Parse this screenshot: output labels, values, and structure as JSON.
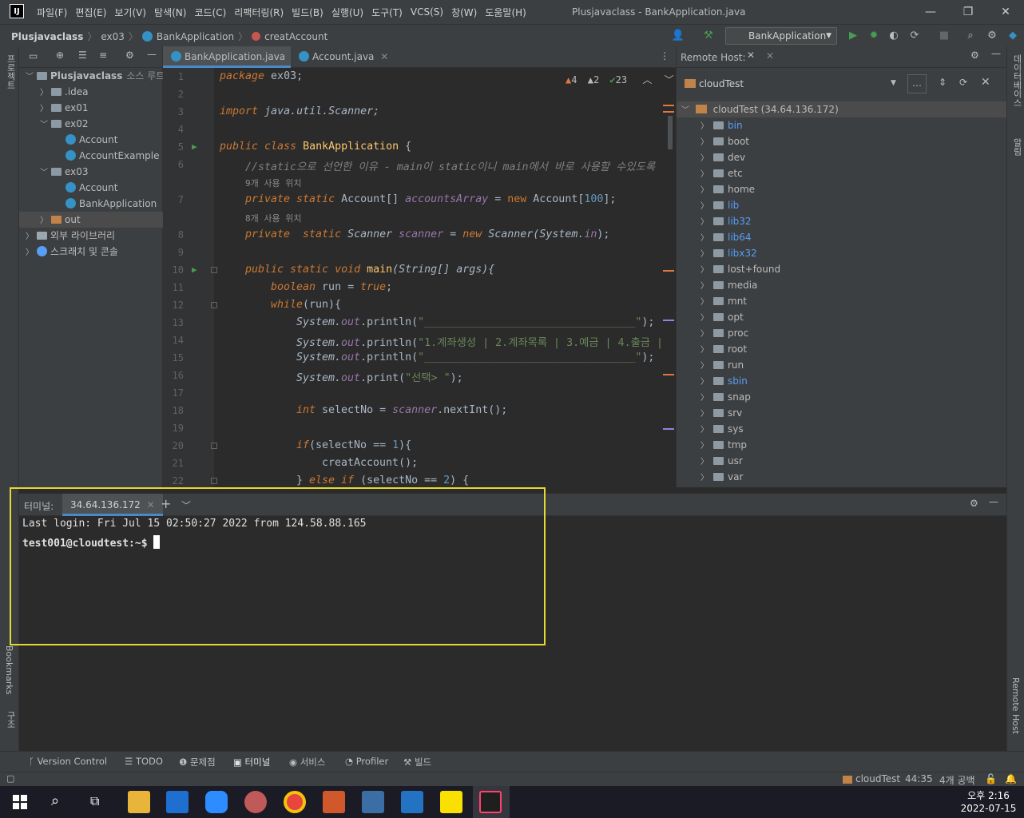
{
  "window": {
    "title": "Plusjavaclass - BankApplication.java",
    "menus": [
      "파일(F)",
      "편집(E)",
      "보기(V)",
      "탐색(N)",
      "코드(C)",
      "리팩터링(R)",
      "빌드(B)",
      "실행(U)",
      "도구(T)",
      "VCS(S)",
      "창(W)",
      "도움말(H)"
    ],
    "logo": "IJ"
  },
  "breadcrumb": [
    "Plusjavaclass",
    "ex03",
    "BankApplication",
    "creatAccount"
  ],
  "run_config": "BankApplication",
  "left_strip": {
    "project": "프로젝트",
    "bookmarks": "Bookmarks",
    "structure": "구조"
  },
  "project_tree": [
    {
      "label": "Plusjavaclass",
      "suffix": "소스 루트,",
      "indent": 0,
      "type": "module",
      "open": true
    },
    {
      "label": ".idea",
      "indent": 1,
      "type": "folder",
      "open": false
    },
    {
      "label": "ex01",
      "indent": 1,
      "type": "folder",
      "open": false
    },
    {
      "label": "ex02",
      "indent": 1,
      "type": "folder",
      "open": true
    },
    {
      "label": "Account",
      "indent": 2,
      "type": "class"
    },
    {
      "label": "AccountExample",
      "indent": 2,
      "type": "class"
    },
    {
      "label": "ex03",
      "indent": 1,
      "type": "folder",
      "open": true
    },
    {
      "label": "Account",
      "indent": 2,
      "type": "class"
    },
    {
      "label": "BankApplication",
      "indent": 2,
      "type": "class"
    },
    {
      "label": "out",
      "indent": 1,
      "type": "folder-orange",
      "open": false,
      "selected": true
    },
    {
      "label": "외부 라이브러리",
      "indent": 0,
      "type": "lib",
      "open": false
    },
    {
      "label": "스크래치 및 콘솔",
      "indent": 0,
      "type": "scratch",
      "open": false
    }
  ],
  "editor_tabs": [
    {
      "label": "BankApplication.java",
      "active": true
    },
    {
      "label": "Account.java",
      "active": false
    }
  ],
  "inspections": {
    "errors": "4",
    "warnings": "2",
    "ok": "23"
  },
  "hints": {
    "line6": "9개 사용 위치",
    "line7": "8개 사용 위치"
  },
  "line_numbers": [
    "1",
    "2",
    "3",
    "4",
    "5",
    "6",
    "7",
    "8",
    "9",
    "10",
    "11",
    "12",
    "13",
    "14",
    "15",
    "16",
    "17",
    "18",
    "19",
    "20",
    "21",
    "22"
  ],
  "code": {
    "l1_kw": "package",
    "l1_rest": " ex03;",
    "l3_kw": "import",
    "l3_rest": " java.util.Scanner;",
    "l5_kw": "public class",
    "l5_name": " BankApplication",
    "l5_rest": " {",
    "l6": "//static으로 선언한 이유 - main이 static이니 main에서 바로 사용할 수있도록",
    "l7_kw": "private static",
    "l7_type": " Account[] ",
    "l7_field": "accountsArray",
    "l7_eq": " = ",
    "l7_new": "new",
    "l7_ctor": " Account[",
    "l7_num": "100",
    "l7_end": "];",
    "l8_kw": "private  static",
    "l8_type": " Scanner ",
    "l8_field": "scanner",
    "l8_eq": " = ",
    "l8_new": "new",
    "l8_ctor": " Scanner(System.",
    "l8_in": "in",
    "l8_end": ");",
    "l10_kw": "public static void",
    "l10_name": " main",
    "l10_rest": "(String[] args){",
    "l11_kw": "boolean",
    "l11_rest": " run = ",
    "l11_true": "true",
    "l11_end": ";",
    "l12_kw": "while",
    "l12_rest": "(run){",
    "l13_a": "System.",
    "l13_out": "out",
    "l13_b": ".println(",
    "l13_str": "\"_________________________________\"",
    "l13_end": ");",
    "l14_a": "System.",
    "l14_out": "out",
    "l14_b": ".println(",
    "l14_str": "\"1.계좌생성 | 2.계좌목록 | 3.예금 | 4.출금 |",
    "l14_end": "",
    "l15_a": "System.",
    "l15_out": "out",
    "l15_b": ".println(",
    "l15_str": "\"_________________________________\"",
    "l15_end": ");",
    "l16_a": "System.",
    "l16_out": "out",
    "l16_b": ".print(",
    "l16_str": "\"선택> \"",
    "l16_end": ");",
    "l18_kw": "int",
    "l18_rest": " selectNo = ",
    "l18_field": "scanner",
    "l18_end": ".nextInt();",
    "l20_kw": "if",
    "l20_rest": "(selectNo == ",
    "l20_num": "1",
    "l20_end": "){",
    "l21": "creatAccount();",
    "l22_a": "} ",
    "l22_kw": "else if",
    "l22_rest": " (selectNo == ",
    "l22_num": "2",
    "l22_end": ") {"
  },
  "remote_host": {
    "title": "Remote Host:",
    "server": "cloudTest",
    "root": "cloudTest (34.64.136.172)",
    "dirs": [
      {
        "name": "bin",
        "link": true
      },
      {
        "name": "boot",
        "link": false
      },
      {
        "name": "dev",
        "link": false
      },
      {
        "name": "etc",
        "link": false
      },
      {
        "name": "home",
        "link": false
      },
      {
        "name": "lib",
        "link": true
      },
      {
        "name": "lib32",
        "link": true
      },
      {
        "name": "lib64",
        "link": true
      },
      {
        "name": "libx32",
        "link": true
      },
      {
        "name": "lost+found",
        "link": false
      },
      {
        "name": "media",
        "link": false
      },
      {
        "name": "mnt",
        "link": false
      },
      {
        "name": "opt",
        "link": false
      },
      {
        "name": "proc",
        "link": false
      },
      {
        "name": "root",
        "link": false
      },
      {
        "name": "run",
        "link": false
      },
      {
        "name": "sbin",
        "link": true
      },
      {
        "name": "snap",
        "link": false
      },
      {
        "name": "srv",
        "link": false
      },
      {
        "name": "sys",
        "link": false
      },
      {
        "name": "tmp",
        "link": false
      },
      {
        "name": "usr",
        "link": false
      },
      {
        "name": "var",
        "link": false
      }
    ]
  },
  "right_strip": {
    "database": "데이터베이스",
    "notifications": "알림",
    "remote_host": "Remote Host"
  },
  "terminal": {
    "label": "터미널:",
    "tab": "34.64.136.172",
    "line1": "Last login: Fri Jul 15 02:50:27 2022 from 124.58.88.165",
    "prompt": "test001@cloudtest:~$ "
  },
  "bottom_tools": [
    "Version Control",
    "TODO",
    "문제점",
    "터미널",
    "서비스",
    "Profiler",
    "빌드"
  ],
  "status": {
    "server": "cloudTest",
    "position": "44:35",
    "indent": "4개 공백"
  },
  "clock": {
    "time": "오후 2:16",
    "date": "2022-07-15"
  },
  "colors": {
    "accent": "#4a88c7",
    "highlight": "#e5d830",
    "run_green": "#499c54"
  }
}
